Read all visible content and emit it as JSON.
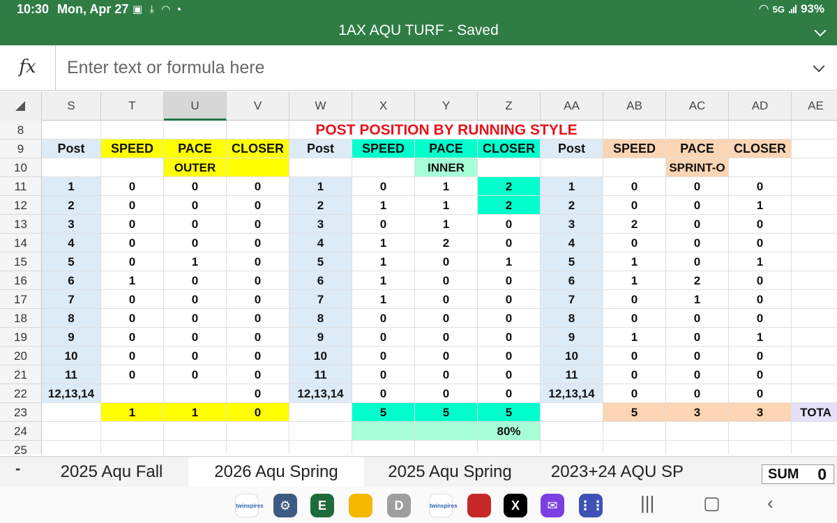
{
  "status": {
    "time": "10:30",
    "date": "Mon, Apr 27",
    "network": "5G",
    "battery": "93%"
  },
  "document": {
    "title": "1AX AQU TURF - Saved"
  },
  "formula_bar": {
    "fx_label": "fx",
    "placeholder": "Enter text or formula here"
  },
  "columns": [
    "S",
    "T",
    "U",
    "V",
    "W",
    "X",
    "Y",
    "Z",
    "AA",
    "AB",
    "AC",
    "AD",
    "AE"
  ],
  "selected_column": "U",
  "sheet": {
    "title_text": "POST POSITION BY RUNNING STYLE",
    "header_row": [
      "Post",
      "SPEED",
      "PACE",
      "CLOSER",
      "Post",
      "SPEED",
      "PACE",
      "CLOSER",
      "Post",
      "SPEED",
      "PACE",
      "CLOSER"
    ],
    "group_labels": {
      "outer": "OUTER",
      "inner": "INNER",
      "sprint": "SPRINT-O"
    },
    "data_rows": [
      [
        "1",
        "0",
        "0",
        "0",
        "1",
        "0",
        "1",
        "2",
        "1",
        "0",
        "0",
        "0"
      ],
      [
        "2",
        "0",
        "0",
        "0",
        "2",
        "1",
        "1",
        "2",
        "2",
        "0",
        "0",
        "1"
      ],
      [
        "3",
        "0",
        "0",
        "0",
        "3",
        "0",
        "1",
        "0",
        "3",
        "2",
        "0",
        "0"
      ],
      [
        "4",
        "0",
        "0",
        "0",
        "4",
        "1",
        "2",
        "0",
        "4",
        "0",
        "0",
        "0"
      ],
      [
        "5",
        "0",
        "1",
        "0",
        "5",
        "1",
        "0",
        "1",
        "5",
        "1",
        "0",
        "1"
      ],
      [
        "6",
        "1",
        "0",
        "0",
        "6",
        "1",
        "0",
        "0",
        "6",
        "1",
        "2",
        "0"
      ],
      [
        "7",
        "0",
        "0",
        "0",
        "7",
        "1",
        "0",
        "0",
        "7",
        "0",
        "1",
        "0"
      ],
      [
        "8",
        "0",
        "0",
        "0",
        "8",
        "0",
        "0",
        "0",
        "8",
        "0",
        "0",
        "0"
      ],
      [
        "9",
        "0",
        "0",
        "0",
        "9",
        "0",
        "0",
        "0",
        "9",
        "1",
        "0",
        "1"
      ],
      [
        "10",
        "0",
        "0",
        "0",
        "10",
        "0",
        "0",
        "0",
        "10",
        "0",
        "0",
        "0"
      ],
      [
        "11",
        "0",
        "0",
        "0",
        "11",
        "0",
        "0",
        "0",
        "11",
        "0",
        "0",
        "0"
      ],
      [
        "12,13,14",
        "",
        "",
        "0",
        "12,13,14",
        "0",
        "0",
        "0",
        "12,13,14",
        "0",
        "0",
        "0"
      ]
    ],
    "totals_row": [
      "",
      "1",
      "1",
      "0",
      "",
      "5",
      "5",
      "5",
      "",
      "5",
      "3",
      "3",
      "TOTA"
    ],
    "percent_row": {
      "value": "80%"
    }
  },
  "sheet_tabs": [
    {
      "label": "2025 Aqu Fall",
      "active": false
    },
    {
      "label": "2026 Aqu Spring",
      "active": true
    },
    {
      "label": "2025 Aqu Spring",
      "active": false
    },
    {
      "label": "2023+24 AQU SP",
      "active": false
    }
  ],
  "tab_menu_label": "-",
  "summary": {
    "label": "SUM",
    "value": "0"
  },
  "taskbar_apps": [
    {
      "name": "twinspires",
      "label": "twinspires",
      "color": "#ffffff"
    },
    {
      "name": "settings",
      "label": "⚙",
      "color": "#3d5a80"
    },
    {
      "name": "excel",
      "label": "E",
      "color": "#1e6b3a"
    },
    {
      "name": "files",
      "label": "",
      "color": "#f5b800"
    },
    {
      "name": "chrome-d",
      "label": "D",
      "color": "#9e9e9e"
    },
    {
      "name": "twinspires-2",
      "label": "twinspires",
      "color": "#ffffff"
    },
    {
      "name": "chrome-red",
      "label": "",
      "color": "#c62828"
    },
    {
      "name": "x",
      "label": "X",
      "color": "#000000"
    },
    {
      "name": "mail",
      "label": "✉",
      "color": "#7b3fe4"
    },
    {
      "name": "apps",
      "label": "⋮⋮",
      "color": "#3f51b5"
    }
  ],
  "colors": {
    "topbar": "#2f7d45",
    "title_red": "#e8141b",
    "post_blue": "#ddebf7",
    "outer_yellow": "#ffff00",
    "inner_teal": "#00ffcc",
    "inner_mint": "#a6ffd6",
    "sprint_peach": "#fcd5b4"
  }
}
